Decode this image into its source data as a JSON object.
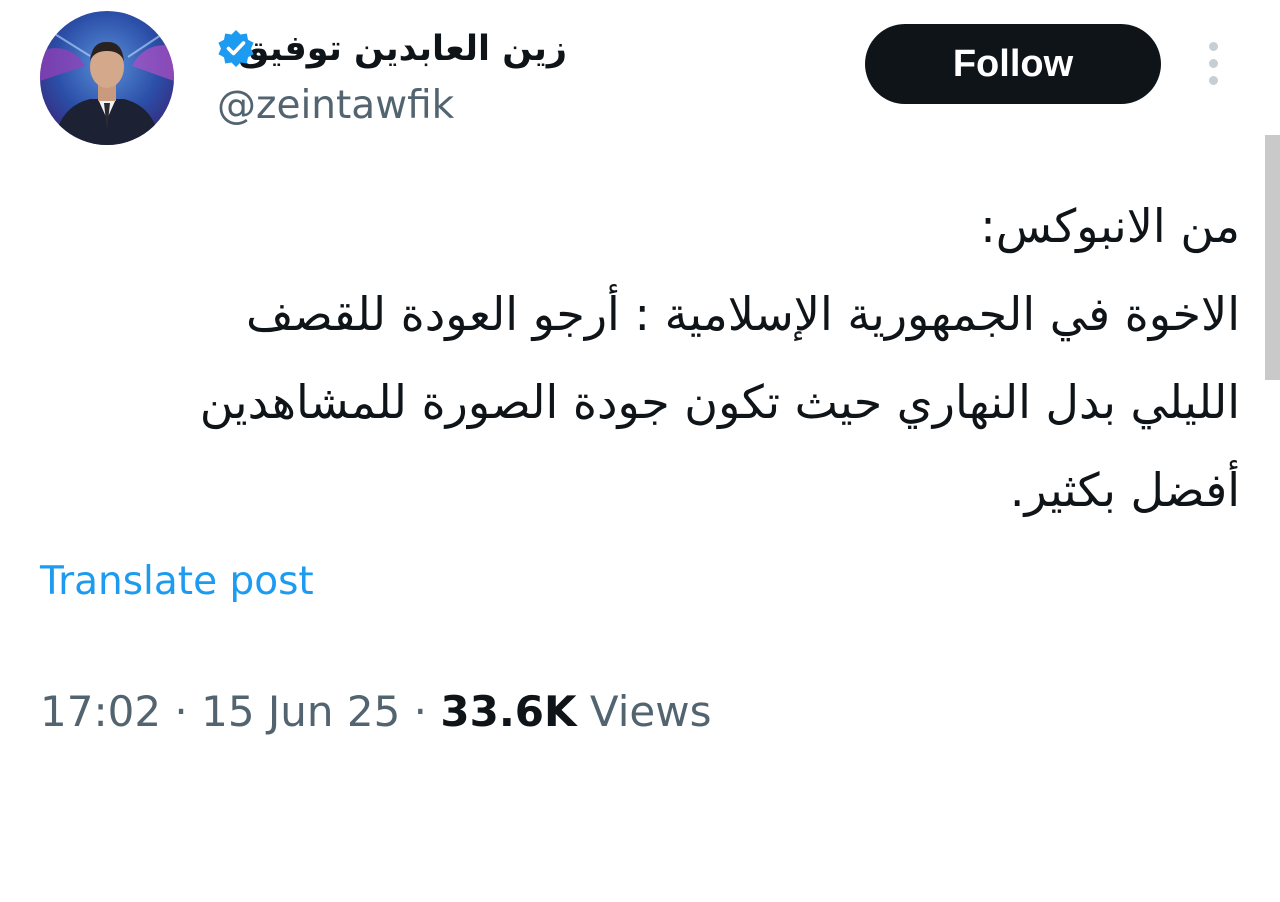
{
  "author": {
    "display_name": "زين العابدين توفيق",
    "handle": "@zeintawfik",
    "verified": true,
    "avatar_icon": "profile-photo-news-anchor"
  },
  "actions": {
    "follow_label": "Follow",
    "more_icon": "vertical-ellipsis-icon"
  },
  "tweet": {
    "lines": [
      "من الانبوكس:",
      "الاخوة في الجمهورية الإسلامية : أرجو العودة للقصف",
      "الليلي بدل النهاري حيث تكون جودة الصورة للمشاهدين",
      "أفضل بكثير."
    ],
    "translate_label": "Translate post"
  },
  "meta": {
    "time": "17:02",
    "separator": " · ",
    "date": "15 Jun 25",
    "views_count": "33.6K",
    "views_label": "Views"
  },
  "colors": {
    "text": "#0f1419",
    "secondary": "#536471",
    "link": "#1d9bf0",
    "verified": "#1d9bf0",
    "follow_bg": "#0f1419"
  }
}
